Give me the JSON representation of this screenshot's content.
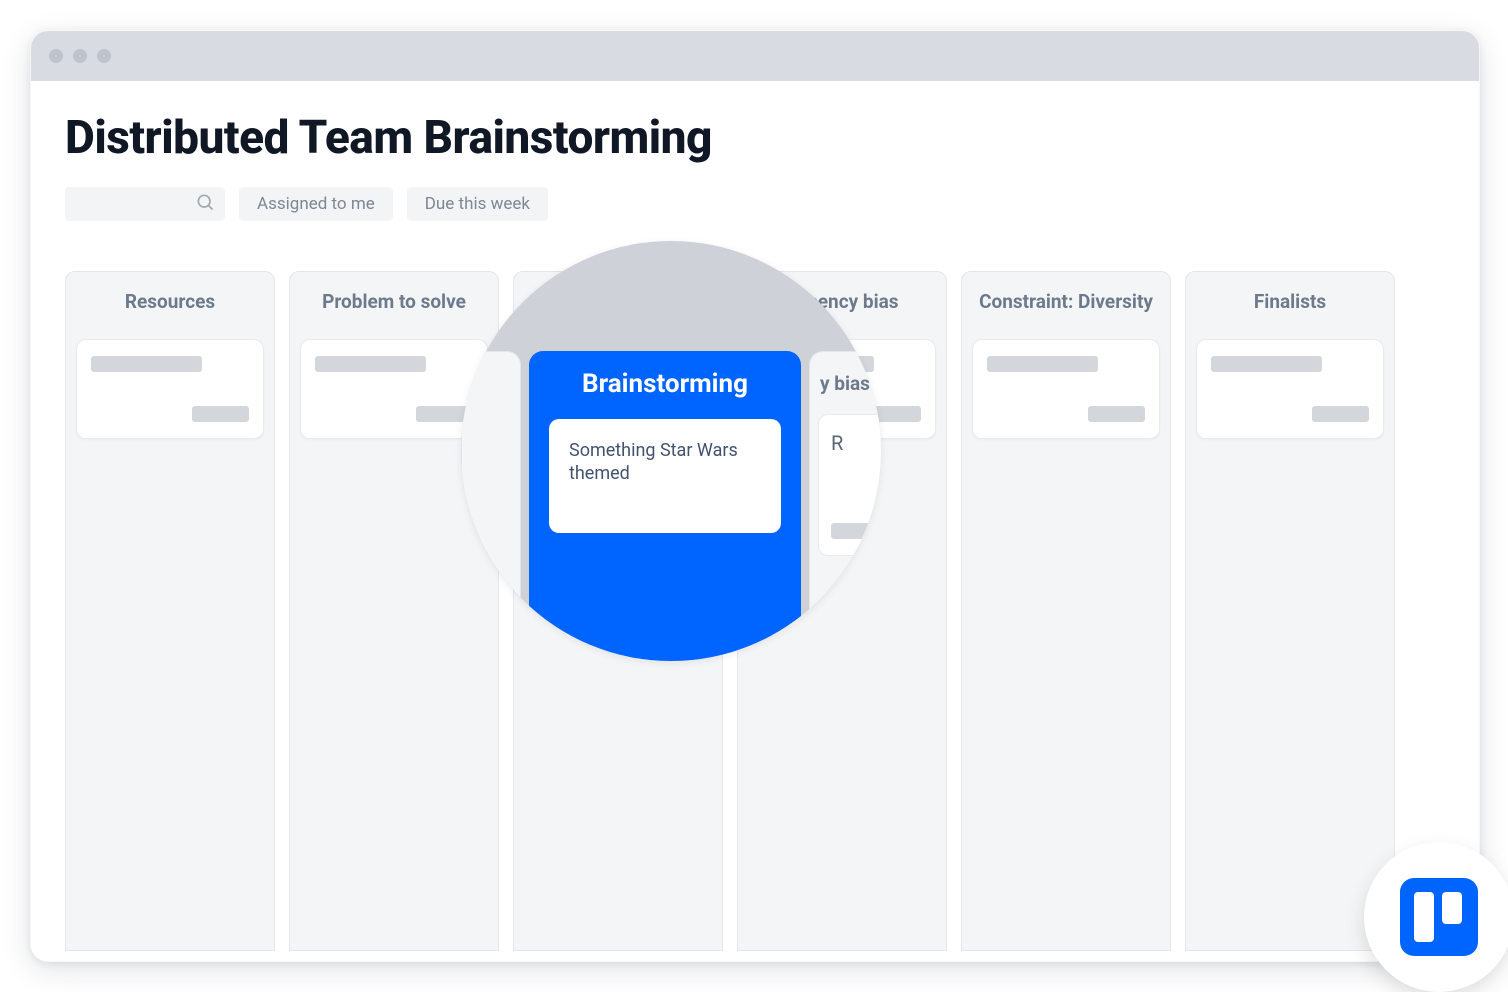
{
  "board": {
    "title": "Distributed Team Brainstorming"
  },
  "filters": {
    "assigned": "Assigned to me",
    "due": "Due this week"
  },
  "columns": [
    {
      "title": "Resources"
    },
    {
      "title": "Problem to solve"
    },
    {
      "title": "Brainstorming"
    },
    {
      "title": "Recency bias"
    },
    {
      "title": "Constraint: Diversity"
    },
    {
      "title": "Finalists"
    }
  ],
  "callout": {
    "column_title": "Brainstorming",
    "card_text": "Something Star Wars themed",
    "right_peek_head_fragment": "y bias",
    "right_peek_card_fragment": "R"
  },
  "app_logo_name": "trello-logo",
  "colors": {
    "accent": "#0065ff"
  }
}
